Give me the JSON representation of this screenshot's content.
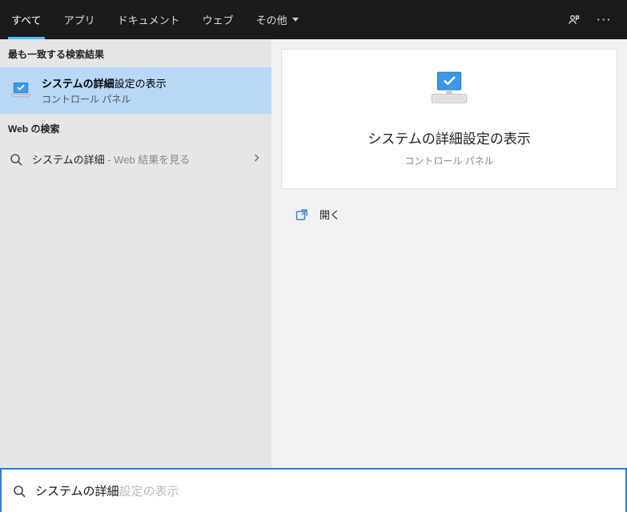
{
  "tabs": {
    "all": "すべて",
    "apps": "アプリ",
    "documents": "ドキュメント",
    "web": "ウェブ",
    "more": "その他"
  },
  "left": {
    "best_match_header": "最も一致する検索結果",
    "best_match": {
      "title_bold": "システムの詳細",
      "title_rest": "設定の表示",
      "subtitle": "コントロール パネル"
    },
    "web_header": "Web の検索",
    "web_item": {
      "query": "システムの詳細",
      "suffix": " - Web 結果を見る"
    }
  },
  "detail": {
    "title": "システムの詳細設定の表示",
    "subtitle": "コントロール パネル",
    "open_label": "開く"
  },
  "search": {
    "typed": "システムの詳細",
    "suggestion_rest": "設定の表示"
  }
}
